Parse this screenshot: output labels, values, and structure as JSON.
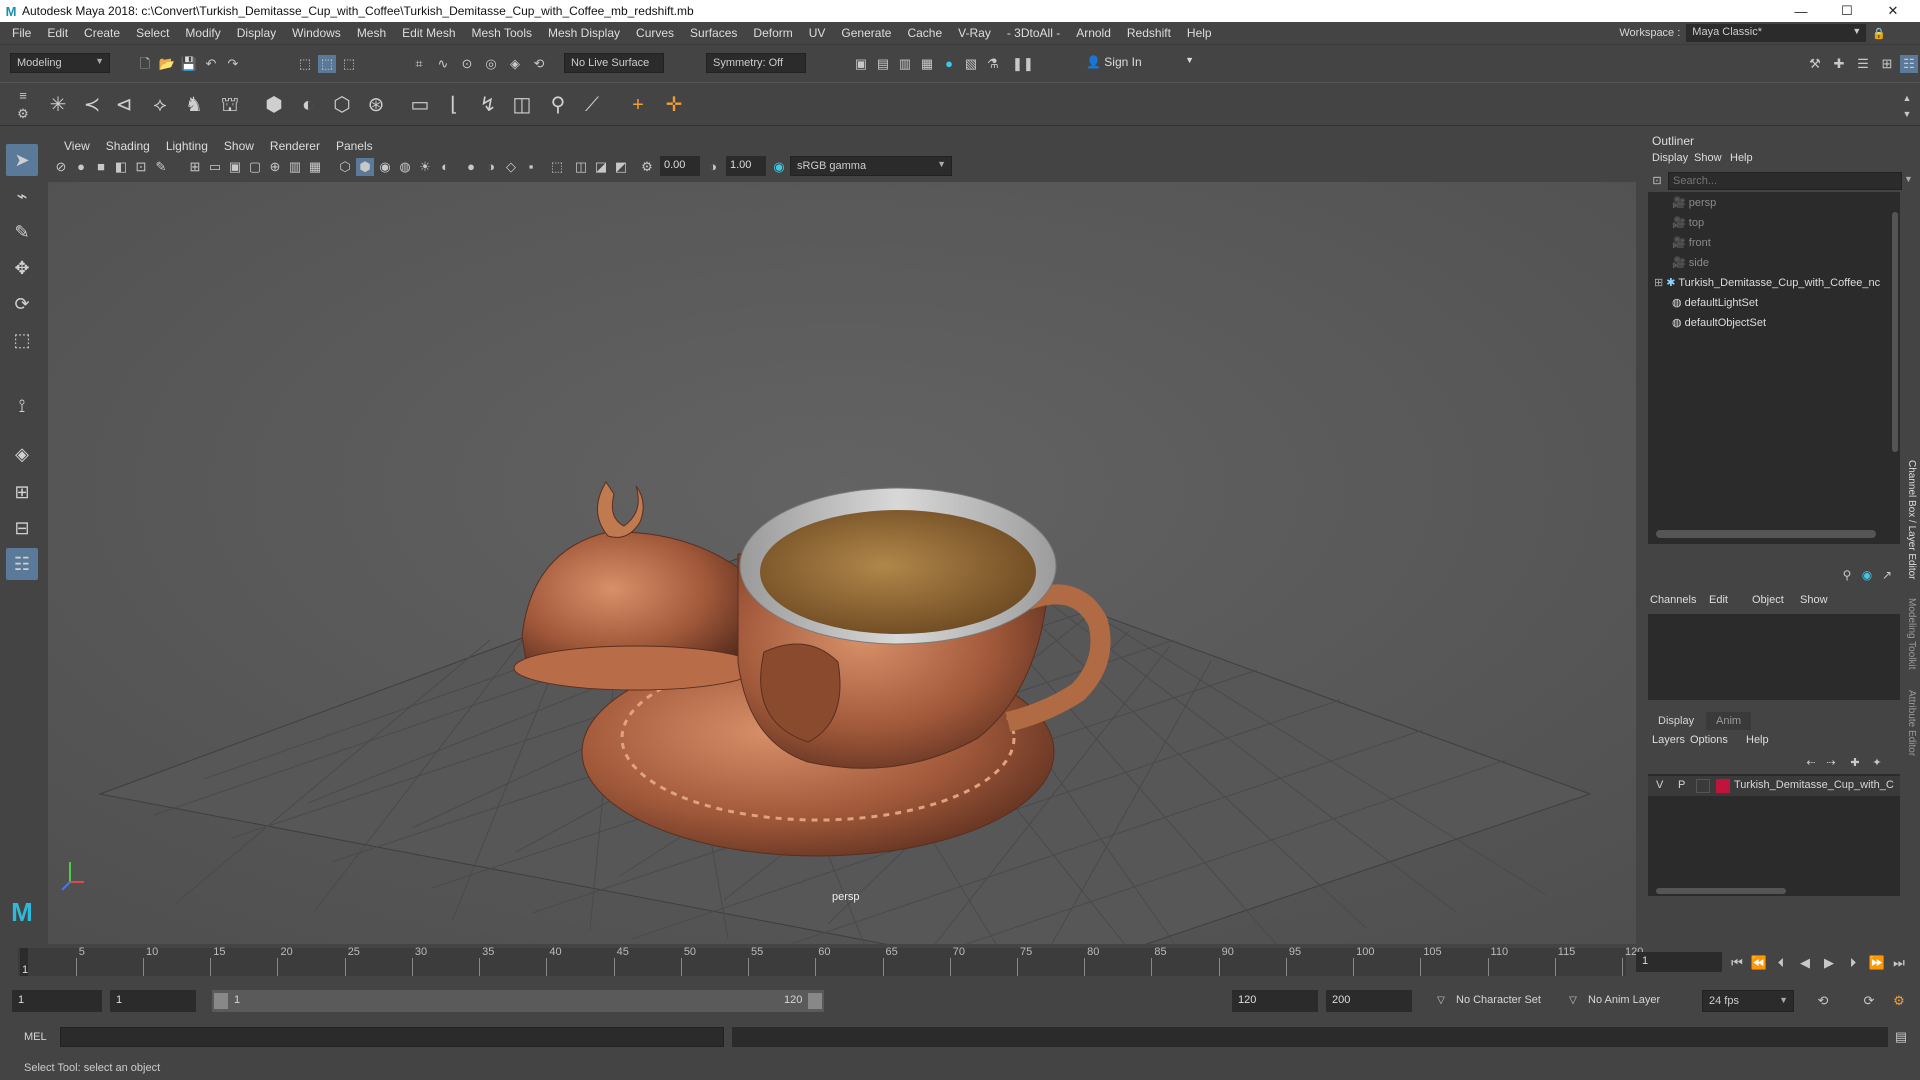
{
  "window": {
    "title": "Autodesk Maya 2018: c:\\Convert\\Turkish_Demitasse_Cup_with_Coffee\\Turkish_Demitasse_Cup_with_Coffee_mb_redshift.mb",
    "logo": "M",
    "minimize": "—",
    "maximize": "☐",
    "close": "✕"
  },
  "menubar": {
    "items": [
      "File",
      "Edit",
      "Create",
      "Select",
      "Modify",
      "Display",
      "Windows",
      "Mesh",
      "Edit Mesh",
      "Mesh Tools",
      "Mesh Display",
      "Curves",
      "Surfaces",
      "Deform",
      "UV",
      "Generate",
      "Cache",
      "V-Ray",
      "- 3DtoAll -",
      "Arnold",
      "Redshift",
      "Help"
    ],
    "workspace_label": "Workspace :",
    "workspace_value": "Maya Classic*"
  },
  "statusline": {
    "mode": "Modeling",
    "live_surface": "No Live Surface",
    "symmetry": "Symmetry: Off",
    "sign_in": "Sign In"
  },
  "viewport": {
    "menu": [
      "View",
      "Shading",
      "Lighting",
      "Show",
      "Renderer",
      "Panels"
    ],
    "exposure": "0.00",
    "gamma": "1.00",
    "colorspace": "sRGB gamma",
    "camera_label": "persp"
  },
  "outliner": {
    "title": "Outliner",
    "menu": [
      "Display",
      "Show",
      "Help"
    ],
    "search_placeholder": "Search...",
    "items": [
      {
        "label": "persp",
        "icon": "camera-icon",
        "dim": true
      },
      {
        "label": "top",
        "icon": "camera-icon",
        "dim": true
      },
      {
        "label": "front",
        "icon": "camera-icon",
        "dim": true
      },
      {
        "label": "side",
        "icon": "camera-icon",
        "dim": true
      },
      {
        "label": "Turkish_Demitasse_Cup_with_Coffee_nc",
        "icon": "group-icon",
        "dim": false,
        "expandable": true
      },
      {
        "label": "defaultLightSet",
        "icon": "set-icon",
        "dim": false
      },
      {
        "label": "defaultObjectSet",
        "icon": "set-icon",
        "dim": false
      }
    ]
  },
  "channelbox": {
    "menu": [
      "Channels",
      "Edit",
      "Object",
      "Show"
    ],
    "side_tab": "Channel Box / Layer Editor",
    "side_tab2": "Modeling Toolkit",
    "side_tab3": "Attribute Editor"
  },
  "layers": {
    "tabs": [
      "Display",
      "Anim"
    ],
    "menu": [
      "Layers",
      "Options",
      "Help"
    ],
    "row": {
      "v": "V",
      "p": "P",
      "name": "Turkish_Demitasse_Cup_with_C",
      "color": "#c0143c"
    }
  },
  "timeline": {
    "ticks": [
      "5",
      "10",
      "15",
      "20",
      "25",
      "30",
      "35",
      "40",
      "45",
      "50",
      "55",
      "60",
      "65",
      "70",
      "75",
      "80",
      "85",
      "90",
      "95",
      "100",
      "105",
      "110",
      "115",
      "120"
    ],
    "start_marker": "1",
    "current_frame": "1"
  },
  "range": {
    "start": "1",
    "start2": "1",
    "slider_start": "1",
    "slider_end": "120",
    "end": "120",
    "end2": "200",
    "character_set": "No Character Set",
    "anim_layer": "No Anim Layer",
    "fps": "24 fps"
  },
  "mel": {
    "label": "MEL"
  },
  "help": {
    "text": "Select Tool: select an object"
  }
}
